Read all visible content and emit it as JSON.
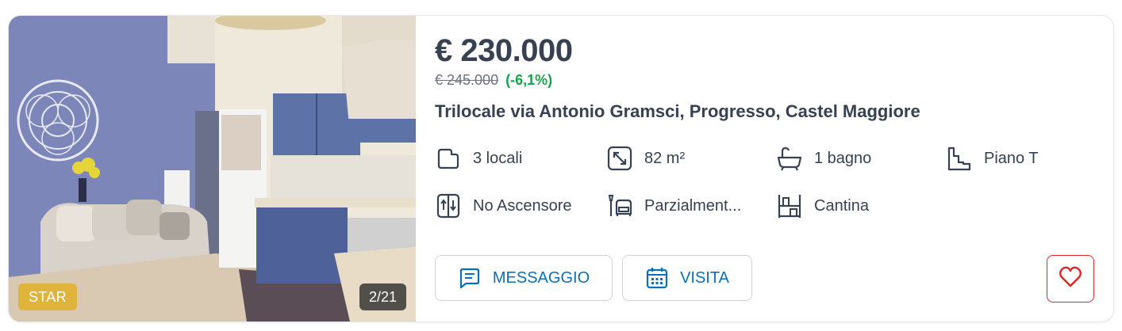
{
  "listing": {
    "badge": "STAR",
    "photo_counter": "2/21",
    "price": "€ 230.000",
    "old_price": "€ 245.000",
    "price_change": "(-6,1%)",
    "title": "Trilocale via Antonio Gramsci, Progresso, Castel Maggiore"
  },
  "features": {
    "rooms": "3 locali",
    "area": "82 m²",
    "bathrooms": "1 bagno",
    "floor": "Piano T",
    "elevator": "No Ascensore",
    "furnished": "Parzialment...",
    "cellar": "Cantina"
  },
  "actions": {
    "message_label": "MESSAGGIO",
    "visit_label": "VISITA"
  },
  "colors": {
    "accent_blue": "#0b6eb9",
    "badge_gold": "#e0b43c",
    "price_drop_green": "#16a34a",
    "favorite_red": "#dc2626"
  },
  "icons": [
    "rooms-icon",
    "area-icon",
    "bathtub-icon",
    "stairs-icon",
    "elevator-icon",
    "sofa-icon",
    "shelves-icon",
    "message-icon",
    "calendar-icon",
    "heart-icon"
  ]
}
